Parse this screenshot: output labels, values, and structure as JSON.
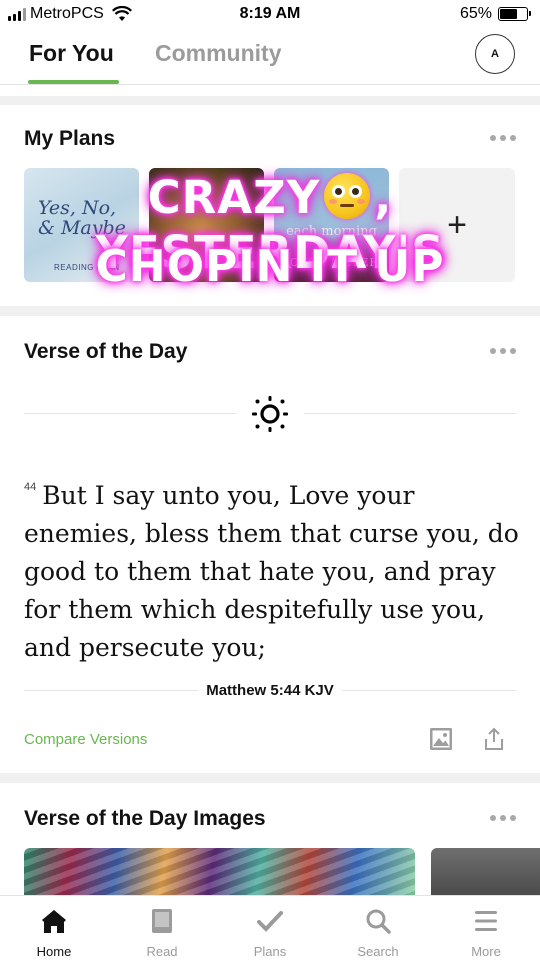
{
  "status_bar": {
    "carrier": "MetroPCS",
    "time": "8:19 AM",
    "battery": "65%",
    "battery_level": 0.65
  },
  "top_tabs": [
    {
      "label": "For You",
      "active": true
    },
    {
      "label": "Community",
      "active": false
    }
  ],
  "avatar_initial": "A",
  "my_plans": {
    "title": "My Plans",
    "plans": [
      {
        "title_line1": "Yes, No,",
        "title_line2": "& Maybe",
        "label": "READING PLAN"
      },
      {},
      {
        "line1": "each morning",
        "line2": "JOYCE MEYER"
      }
    ],
    "add_symbol": "+"
  },
  "overlay": {
    "line1_before": "CRAZY",
    "line1_after": ", YESTERDAY'S",
    "line2": "CHOPIN IT UP"
  },
  "verse_of_day": {
    "title": "Verse of the Day",
    "verse_number": "44",
    "text": "But I say unto you, Love your enemies, bless them that curse you, do good to them that hate you, and pray for them which despitefully use you, and persecute you;",
    "reference": "Matthew 5:44 KJV",
    "compare_label": "Compare Versions"
  },
  "verse_images": {
    "title": "Verse of the Day Images"
  },
  "bottom_nav": [
    {
      "label": "Home",
      "icon": "home-icon",
      "active": true
    },
    {
      "label": "Read",
      "icon": "book-icon",
      "active": false
    },
    {
      "label": "Plans",
      "icon": "check-icon",
      "active": false
    },
    {
      "label": "Search",
      "icon": "search-icon",
      "active": false
    },
    {
      "label": "More",
      "icon": "menu-icon",
      "active": false
    }
  ],
  "colors": {
    "accent": "#6ab750",
    "overlay_glow": "#ff3bea",
    "inactive": "#9b9b9b"
  }
}
